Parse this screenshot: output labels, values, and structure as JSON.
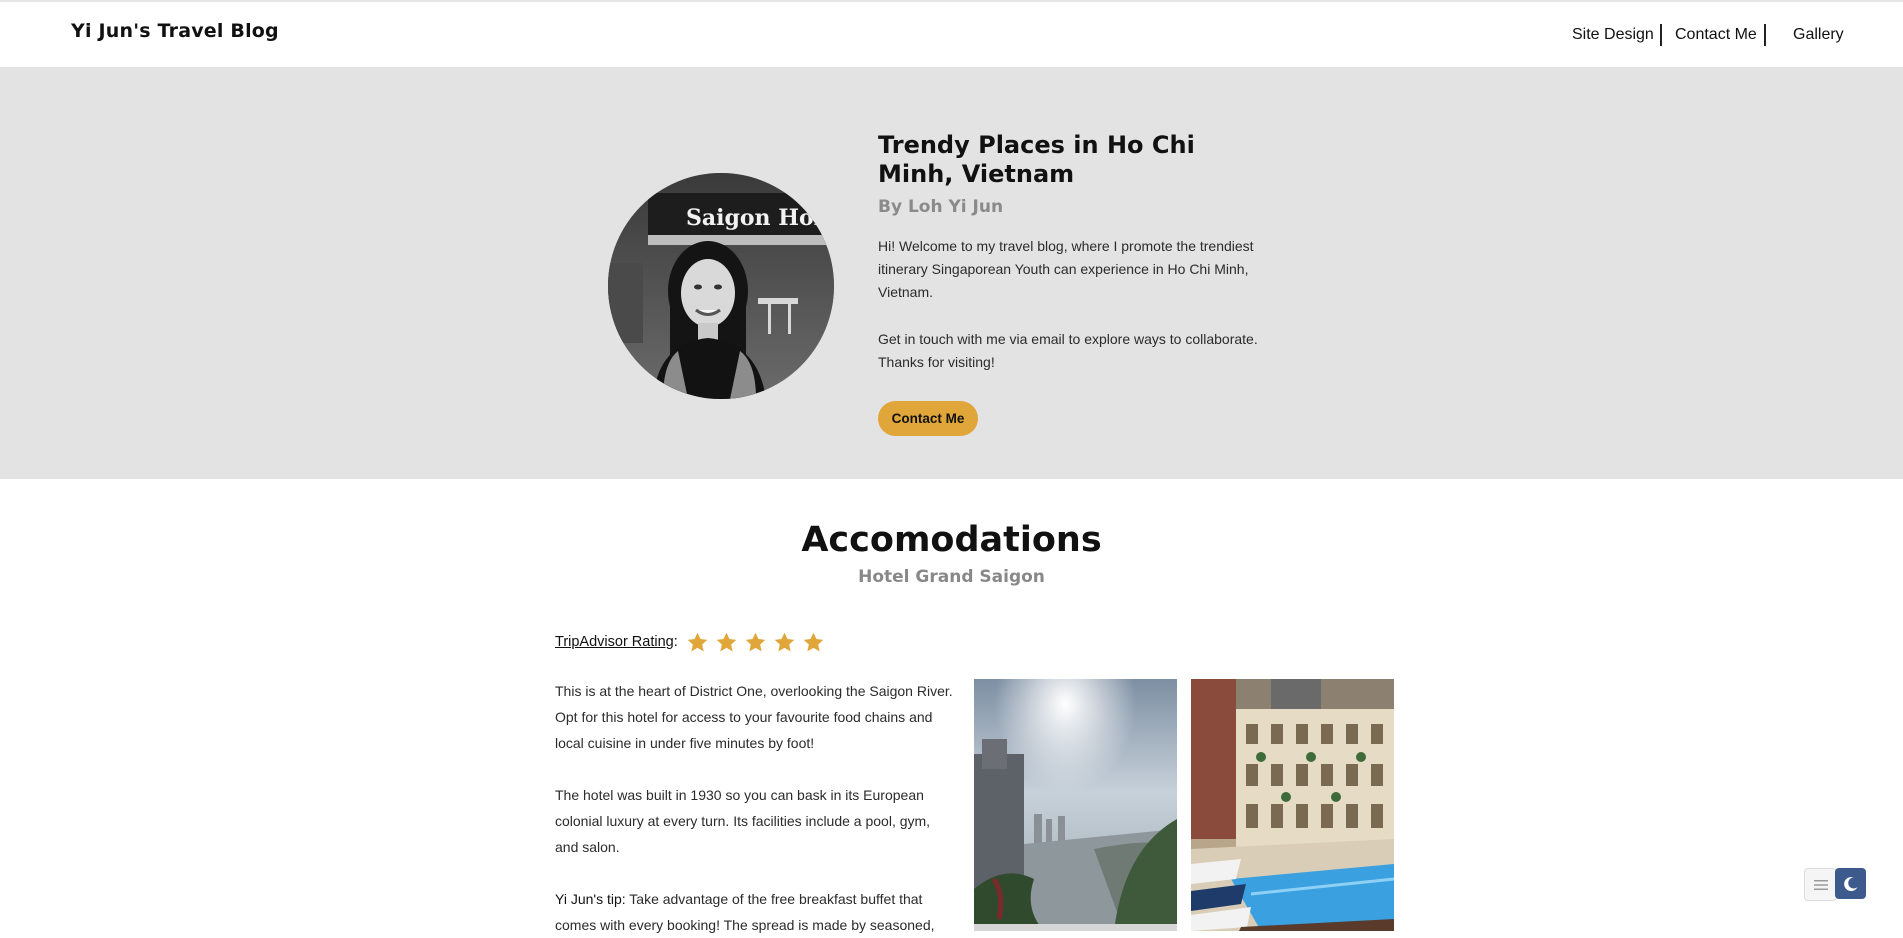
{
  "header": {
    "logo": "Yi Jun's Travel Blog",
    "nav": [
      {
        "label": "Site Design"
      },
      {
        "label": "Contact Me"
      },
      {
        "label": "Gallery"
      }
    ]
  },
  "hero": {
    "title": "Trendy Places in Ho Chi Minh, Vietnam",
    "byline": "By Loh Yi Jun",
    "paragraph1": "Hi! Welcome to my travel blog, where I promote the trendiest itinerary Singaporean Youth can experience in Ho Chi Minh, Vietnam.",
    "paragraph2": "Get in touch with me via email to explore ways to collaborate. Thanks for visiting!",
    "button_label": "Contact Me",
    "avatar_sign": "Saigon Holiday"
  },
  "section": {
    "title": "Accomodations",
    "subtitle": "Hotel Grand Saigon",
    "rating_label": "TripAdvisor Rating",
    "rating_colon": ":",
    "rating_stars": 5,
    "paragraph1": "This is at the heart of District One, overlooking the Saigon River. Opt for this hotel for access to your favourite food chains and local cuisine in under five minutes by foot!",
    "paragraph2": "The hotel was built in 1930 so you can bask in its European colonial luxury at every turn. Its facilities include a pool, gym, and salon.",
    "tip_label": "Yi Jun's tip:",
    "tip_text": " Take advantage of the free breakfast buffet that comes with every booking! The spread is made by seasoned,"
  },
  "colors": {
    "accent": "#e0a63a",
    "hero_bg": "#e3e3e3",
    "subtle_text": "#888888",
    "moon_widget": "#3d5a8c"
  },
  "icons": {
    "star": "star-icon",
    "menu": "menu-lines-icon",
    "moon": "moon-icon"
  }
}
